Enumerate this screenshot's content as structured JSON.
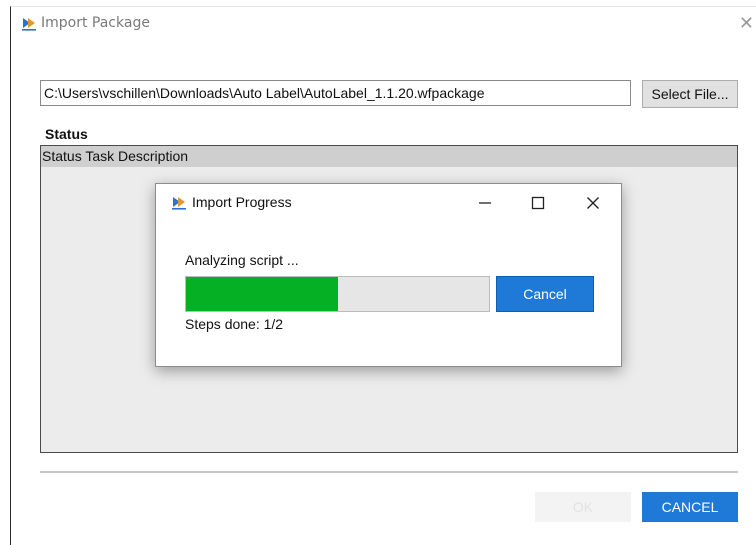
{
  "window": {
    "title": "Import Package",
    "close_glyph": "✕",
    "app_icon": "import-package-icon"
  },
  "file": {
    "path": "C:\\Users\\vschillen\\Downloads\\Auto Label\\AutoLabel_1.1.20.wfpackage",
    "select_label": "Select File..."
  },
  "status": {
    "label": "Status",
    "column_header": "Status Task Description"
  },
  "footer": {
    "ok_label": "OK",
    "cancel_label": "CANCEL"
  },
  "progress_dialog": {
    "title": "Import Progress",
    "status_text": "Analyzing script ...",
    "progress": 0.5,
    "cancel_label": "Cancel",
    "steps_text": "Steps done: 1/2"
  },
  "colors": {
    "accent": "#1e7ad6",
    "progress_fill": "#06b025"
  }
}
